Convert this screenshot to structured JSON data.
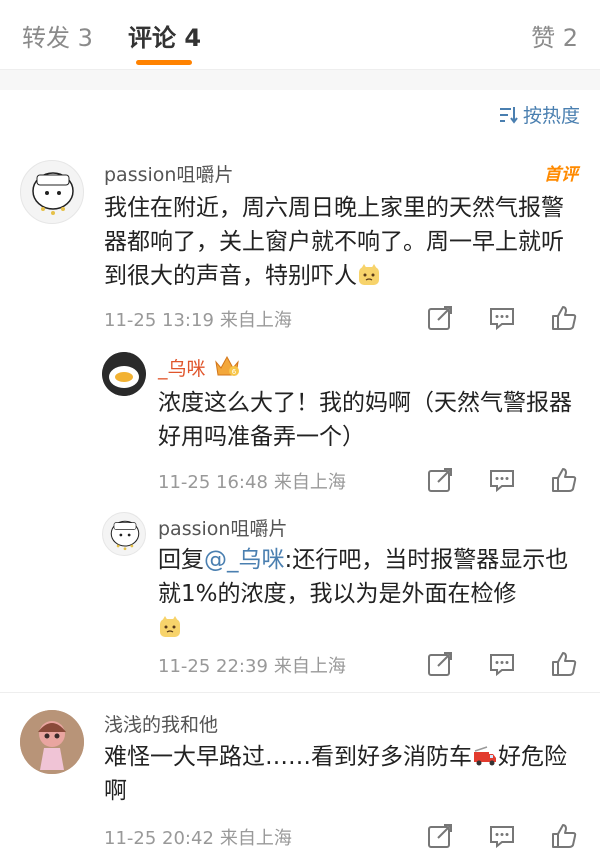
{
  "tabs": {
    "repost": "转发 3",
    "comments": "评论 4",
    "likes": "赞 2"
  },
  "sort": {
    "label": "按热度",
    "icon": "sort-icon"
  },
  "colors": {
    "accent": "#ff8200",
    "link": "#4a7fb0",
    "meta": "#999999"
  },
  "comments": [
    {
      "user": "passion咀嚼片",
      "badge": "首评",
      "text": "我住在附近，周六周日晚上家里的天然气报警器都响了，关上窗户就不响了。周一早上就听到很大的声音，特别吓人",
      "emoji": "cat-emoji",
      "time": "11-25 13:19",
      "location": "来自上海"
    },
    {
      "user": "_乌咪",
      "user_badge": "crown-vip-badge",
      "text": "浓度这么大了！我的妈啊（天然气警报器好用吗准备弄一个）",
      "time": "11-25 16:48",
      "location": "来自上海"
    },
    {
      "user": "passion咀嚼片",
      "reply_prefix": "回复",
      "mention": "@_乌咪",
      "text": ":还行吧，当时报警器显示也就1%的浓度，我以为是外面在检修",
      "emoji": "cat-emoji",
      "time": "11-25 22:39",
      "location": "来自上海"
    },
    {
      "user": "浅浅的我和他",
      "text_before": "难怪一大早路过……看到好多消防车",
      "emoji": "fire-truck-emoji",
      "text_after": "好危险啊",
      "time": "11-25 20:42",
      "location": "来自上海"
    }
  ]
}
